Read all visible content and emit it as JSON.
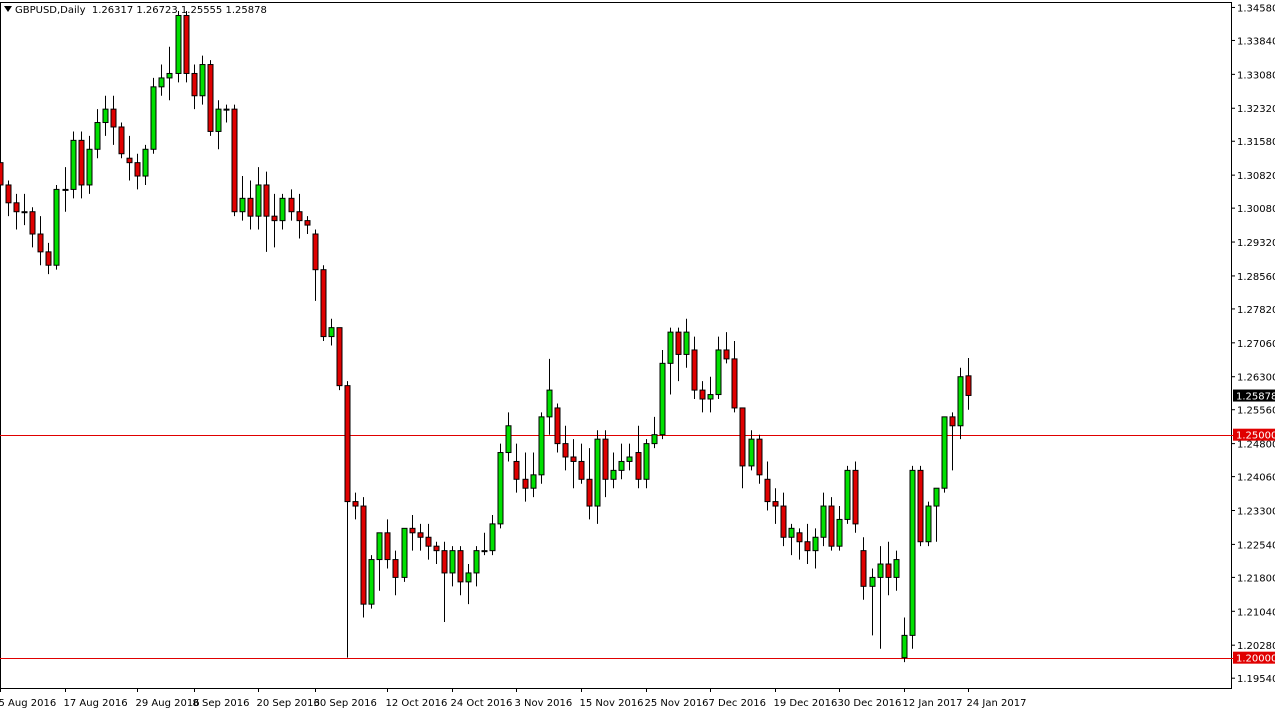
{
  "header": {
    "symbol_timeframe": "GBPUSD,Daily",
    "ohlc": "1.26317 1.26723 1.25555 1.25878"
  },
  "colors": {
    "bull": "#00e000",
    "bear": "#e00000",
    "wick": "#000000",
    "hline": "#e00000",
    "background": "#ffffff",
    "price_tag_bg": "#000000",
    "level_tag_bg": "#e00000"
  },
  "chart_data": {
    "type": "candlestick",
    "title": "GBPUSD,Daily",
    "ylim": [
      1.1932,
      1.3468
    ],
    "grid": false,
    "y_ticks": [
      "1.34580",
      "1.33840",
      "1.33080",
      "1.32320",
      "1.31580",
      "1.30820",
      "1.30080",
      "1.29320",
      "1.28560",
      "1.27820",
      "1.27060",
      "1.26300",
      "1.25560",
      "1.24800",
      "1.24060",
      "1.23300",
      "1.22540",
      "1.21800",
      "1.21040",
      "1.20280",
      "1.19540"
    ],
    "x_ticks": [
      "5 Aug 2016",
      "17 Aug 2016",
      "29 Aug 2016",
      "8 Sep 2016",
      "20 Sep 2016",
      "30 Sep 2016",
      "12 Oct 2016",
      "24 Oct 2016",
      "3 Nov 2016",
      "15 Nov 2016",
      "25 Nov 2016",
      "7 Dec 2016",
      "19 Dec 2016",
      "30 Dec 2016",
      "12 Jan 2017",
      "24 Jan 2017"
    ],
    "x_tick_bar_index": [
      0,
      8,
      17,
      24,
      32,
      39,
      48,
      56,
      64,
      72,
      80,
      88,
      96,
      104,
      112,
      120
    ],
    "current_price": "1.25878",
    "horizontal_lines": [
      {
        "label": "1.25000",
        "value": 1.25
      },
      {
        "label": "1.20000",
        "value": 1.2
      }
    ],
    "candles": [
      [
        1.311,
        1.312,
        1.305,
        1.306
      ],
      [
        1.306,
        1.307,
        1.299,
        1.302
      ],
      [
        1.302,
        1.304,
        1.296,
        1.3
      ],
      [
        1.3,
        1.304,
        1.297,
        1.3
      ],
      [
        1.3,
        1.301,
        1.292,
        1.295
      ],
      [
        1.295,
        1.299,
        1.288,
        1.291
      ],
      [
        1.291,
        1.293,
        1.286,
        1.288
      ],
      [
        1.288,
        1.306,
        1.287,
        1.305
      ],
      [
        1.305,
        1.31,
        1.3,
        1.305
      ],
      [
        1.305,
        1.318,
        1.303,
        1.316
      ],
      [
        1.316,
        1.318,
        1.303,
        1.306
      ],
      [
        1.306,
        1.317,
        1.304,
        1.314
      ],
      [
        1.314,
        1.323,
        1.312,
        1.32
      ],
      [
        1.32,
        1.326,
        1.317,
        1.323
      ],
      [
        1.323,
        1.326,
        1.315,
        1.319
      ],
      [
        1.319,
        1.32,
        1.312,
        1.313
      ],
      [
        1.312,
        1.317,
        1.307,
        1.311
      ],
      [
        1.311,
        1.313,
        1.305,
        1.308
      ],
      [
        1.308,
        1.315,
        1.306,
        1.314
      ],
      [
        1.314,
        1.33,
        1.313,
        1.328
      ],
      [
        1.328,
        1.333,
        1.326,
        1.33
      ],
      [
        1.33,
        1.337,
        1.325,
        1.331
      ],
      [
        1.331,
        1.345,
        1.329,
        1.344
      ],
      [
        1.344,
        1.345,
        1.329,
        1.331
      ],
      [
        1.331,
        1.333,
        1.323,
        1.326
      ],
      [
        1.326,
        1.335,
        1.324,
        1.333
      ],
      [
        1.333,
        1.334,
        1.317,
        1.318
      ],
      [
        1.318,
        1.325,
        1.314,
        1.323
      ],
      [
        1.323,
        1.324,
        1.32,
        1.323
      ],
      [
        1.323,
        1.324,
        1.299,
        1.3
      ],
      [
        1.3,
        1.308,
        1.298,
        1.303
      ],
      [
        1.303,
        1.307,
        1.296,
        1.299
      ],
      [
        1.299,
        1.31,
        1.296,
        1.306
      ],
      [
        1.306,
        1.309,
        1.291,
        1.299
      ],
      [
        1.299,
        1.304,
        1.292,
        1.298
      ],
      [
        1.298,
        1.304,
        1.296,
        1.303
      ],
      [
        1.303,
        1.305,
        1.298,
        1.3
      ],
      [
        1.3,
        1.304,
        1.294,
        1.298
      ],
      [
        1.298,
        1.299,
        1.295,
        1.297
      ],
      [
        1.295,
        1.296,
        1.28,
        1.287
      ],
      [
        1.287,
        1.288,
        1.271,
        1.272
      ],
      [
        1.272,
        1.276,
        1.27,
        1.274
      ],
      [
        1.274,
        1.274,
        1.26,
        1.261
      ],
      [
        1.261,
        1.262,
        1.2,
        1.235
      ],
      [
        1.235,
        1.237,
        1.231,
        1.234
      ],
      [
        1.234,
        1.236,
        1.209,
        1.212
      ],
      [
        1.212,
        1.223,
        1.211,
        1.222
      ],
      [
        1.222,
        1.228,
        1.215,
        1.228
      ],
      [
        1.228,
        1.231,
        1.22,
        1.222
      ],
      [
        1.222,
        1.224,
        1.214,
        1.218
      ],
      [
        1.218,
        1.229,
        1.217,
        1.229
      ],
      [
        1.229,
        1.232,
        1.224,
        1.228
      ],
      [
        1.228,
        1.23,
        1.224,
        1.227
      ],
      [
        1.227,
        1.23,
        1.222,
        1.225
      ],
      [
        1.225,
        1.226,
        1.221,
        1.224
      ],
      [
        1.224,
        1.226,
        1.208,
        1.219
      ],
      [
        1.219,
        1.225,
        1.216,
        1.224
      ],
      [
        1.224,
        1.225,
        1.214,
        1.217
      ],
      [
        1.217,
        1.221,
        1.212,
        1.219
      ],
      [
        1.219,
        1.225,
        1.216,
        1.224
      ],
      [
        1.224,
        1.228,
        1.223,
        1.224
      ],
      [
        1.224,
        1.232,
        1.223,
        1.23
      ],
      [
        1.23,
        1.248,
        1.229,
        1.246
      ],
      [
        1.246,
        1.255,
        1.244,
        1.252
      ],
      [
        1.244,
        1.248,
        1.237,
        1.24
      ],
      [
        1.24,
        1.246,
        1.235,
        1.238
      ],
      [
        1.238,
        1.246,
        1.236,
        1.241
      ],
      [
        1.241,
        1.255,
        1.239,
        1.254
      ],
      [
        1.254,
        1.267,
        1.25,
        1.26
      ],
      [
        1.256,
        1.257,
        1.246,
        1.248
      ],
      [
        1.248,
        1.252,
        1.242,
        1.245
      ],
      [
        1.245,
        1.249,
        1.238,
        1.244
      ],
      [
        1.244,
        1.248,
        1.239,
        1.24
      ],
      [
        1.24,
        1.247,
        1.231,
        1.234
      ],
      [
        1.234,
        1.251,
        1.23,
        1.249
      ],
      [
        1.249,
        1.251,
        1.236,
        1.24
      ],
      [
        1.24,
        1.246,
        1.238,
        1.242
      ],
      [
        1.242,
        1.248,
        1.24,
        1.244
      ],
      [
        1.244,
        1.248,
        1.242,
        1.245
      ],
      [
        1.246,
        1.252,
        1.238,
        1.24
      ],
      [
        1.24,
        1.249,
        1.238,
        1.248
      ],
      [
        1.248,
        1.254,
        1.247,
        1.25
      ],
      [
        1.25,
        1.269,
        1.249,
        1.266
      ],
      [
        1.266,
        1.274,
        1.259,
        1.273
      ],
      [
        1.273,
        1.274,
        1.262,
        1.268
      ],
      [
        1.268,
        1.276,
        1.265,
        1.273
      ],
      [
        1.269,
        1.272,
        1.258,
        1.26
      ],
      [
        1.26,
        1.262,
        1.255,
        1.258
      ],
      [
        1.258,
        1.263,
        1.255,
        1.259
      ],
      [
        1.259,
        1.272,
        1.258,
        1.269
      ],
      [
        1.269,
        1.273,
        1.266,
        1.267
      ],
      [
        1.267,
        1.271,
        1.255,
        1.256
      ],
      [
        1.256,
        1.256,
        1.238,
        1.243
      ],
      [
        1.243,
        1.251,
        1.242,
        1.249
      ],
      [
        1.249,
        1.25,
        1.239,
        1.241
      ],
      [
        1.24,
        1.244,
        1.233,
        1.235
      ],
      [
        1.235,
        1.238,
        1.23,
        1.234
      ],
      [
        1.234,
        1.237,
        1.225,
        1.227
      ],
      [
        1.227,
        1.23,
        1.223,
        1.229
      ],
      [
        1.228,
        1.229,
        1.222,
        1.226
      ],
      [
        1.226,
        1.23,
        1.221,
        1.224
      ],
      [
        1.224,
        1.229,
        1.22,
        1.227
      ],
      [
        1.227,
        1.237,
        1.225,
        1.234
      ],
      [
        1.234,
        1.236,
        1.224,
        1.225
      ],
      [
        1.225,
        1.234,
        1.224,
        1.231
      ],
      [
        1.231,
        1.243,
        1.23,
        1.242
      ],
      [
        1.242,
        1.244,
        1.228,
        1.23
      ],
      [
        1.224,
        1.227,
        1.213,
        1.216
      ],
      [
        1.216,
        1.22,
        1.205,
        1.218
      ],
      [
        1.218,
        1.225,
        1.202,
        1.221
      ],
      [
        1.221,
        1.226,
        1.214,
        1.218
      ],
      [
        1.218,
        1.224,
        1.215,
        1.222
      ],
      [
        1.2,
        1.209,
        1.199,
        1.205
      ],
      [
        1.205,
        1.243,
        1.202,
        1.242
      ],
      [
        1.242,
        1.243,
        1.225,
        1.226
      ],
      [
        1.226,
        1.235,
        1.225,
        1.234
      ],
      [
        1.234,
        1.238,
        1.226,
        1.238
      ],
      [
        1.238,
        1.254,
        1.237,
        1.254
      ],
      [
        1.254,
        1.255,
        1.242,
        1.252
      ],
      [
        1.252,
        1.265,
        1.249,
        1.263
      ],
      [
        1.2632,
        1.2672,
        1.2556,
        1.2588
      ]
    ]
  }
}
